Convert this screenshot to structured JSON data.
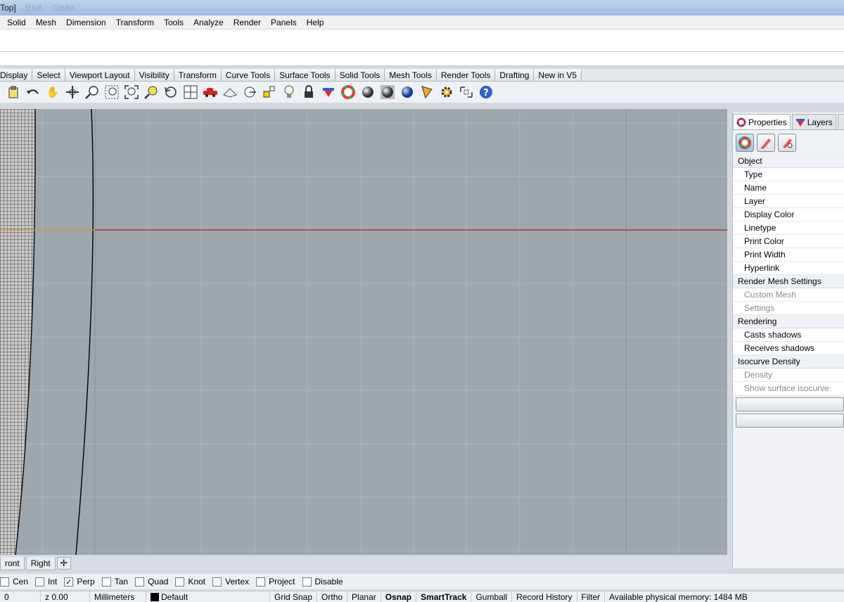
{
  "title_bar": {
    "title": "Top]",
    "blurred": "·Rh8· ·Ob8k·"
  },
  "menu": [
    "Solid",
    "Mesh",
    "Dimension",
    "Transform",
    "Tools",
    "Analyze",
    "Render",
    "Panels",
    "Help"
  ],
  "toolbar_tabs": [
    "Display",
    "Select",
    "Viewport Layout",
    "Visibility",
    "Transform",
    "Curve Tools",
    "Surface Tools",
    "Solid Tools",
    "Mesh Tools",
    "Render Tools",
    "Drafting",
    "New in V5"
  ],
  "toolbar_icons": [
    "clipboard-icon",
    "undo-icon",
    "pan-hand-icon",
    "rotate-view-icon",
    "zoom-icon",
    "zoom-window-icon",
    "zoom-extents-icon",
    "zoom-selected-icon",
    "undo-view-icon",
    "four-viewports-icon",
    "car-icon",
    "plane-icon",
    "cplane-icon",
    "snap-icon",
    "lightbulb-icon",
    "lock-icon",
    "layer-icon",
    "color-wheel-icon",
    "shade-sphere-icon",
    "rendered-sphere-icon",
    "blue-sphere-icon",
    "pen-icon",
    "gear-icon",
    "dimension-icon",
    "help-icon"
  ],
  "viewport_tabs": [
    "ront",
    "Right"
  ],
  "osnap": [
    {
      "label": "Cen",
      "checked": false
    },
    {
      "label": "Int",
      "checked": false
    },
    {
      "label": "Perp",
      "checked": true
    },
    {
      "label": "Tan",
      "checked": false
    },
    {
      "label": "Quad",
      "checked": false
    },
    {
      "label": "Knot",
      "checked": false
    },
    {
      "label": "Vertex",
      "checked": false
    },
    {
      "label": "Project",
      "checked": false
    },
    {
      "label": "Disable",
      "checked": false
    }
  ],
  "status": {
    "x": "0",
    "z": "z 0.00",
    "units": "Millimeters",
    "layer": "Default",
    "grid_snap": "Grid Snap",
    "ortho": "Ortho",
    "planar": "Planar",
    "osnap": "Osnap",
    "smarttrack": "SmartTrack",
    "gumball": "Gumball",
    "record_history": "Record History",
    "filter": "Filter",
    "memory": "Available physical memory: 1484 MB"
  },
  "panel": {
    "tabs": [
      "Properties",
      "Layers"
    ],
    "sections": [
      {
        "title": "Object",
        "rows": [
          {
            "label": "Type",
            "disabled": false
          },
          {
            "label": "Name",
            "disabled": false
          },
          {
            "label": "Layer",
            "disabled": false
          },
          {
            "label": "Display Color",
            "disabled": false
          },
          {
            "label": "Linetype",
            "disabled": false
          },
          {
            "label": "Print Color",
            "disabled": false
          },
          {
            "label": "Print Width",
            "disabled": false
          },
          {
            "label": "Hyperlink",
            "disabled": false
          }
        ]
      },
      {
        "title": "Render Mesh Settings",
        "rows": [
          {
            "label": "Custom Mesh",
            "disabled": true
          },
          {
            "label": "Settings",
            "disabled": true
          }
        ]
      },
      {
        "title": "Rendering",
        "rows": [
          {
            "label": "Casts shadows",
            "disabled": false
          },
          {
            "label": "Receives shadows",
            "disabled": false
          }
        ]
      },
      {
        "title": "Isocurve Density",
        "rows": [
          {
            "label": "Density",
            "disabled": true
          },
          {
            "label": "Show surface isocurve",
            "disabled": true
          }
        ]
      }
    ]
  },
  "colors": {
    "viewport_bg": "#9ea6ae",
    "x_axis": "#b22222",
    "y_axis_segment": "#d4a017"
  }
}
